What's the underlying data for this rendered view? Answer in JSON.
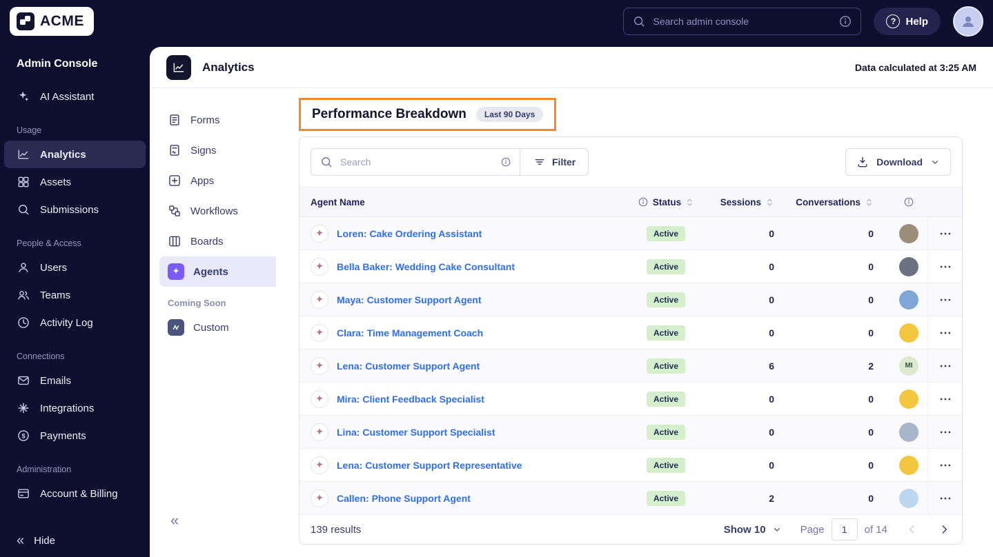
{
  "topbar": {
    "logo_text": "ACME",
    "search_placeholder": "Search admin console",
    "help_label": "Help"
  },
  "sidebar": {
    "title": "Admin Console",
    "ai_assistant_label": "AI Assistant",
    "sections": [
      {
        "label": "Usage",
        "items": [
          {
            "label": "Analytics",
            "active": true
          },
          {
            "label": "Assets"
          },
          {
            "label": "Submissions"
          }
        ]
      },
      {
        "label": "People & Access",
        "items": [
          {
            "label": "Users"
          },
          {
            "label": "Teams"
          },
          {
            "label": "Activity Log"
          }
        ]
      },
      {
        "label": "Connections",
        "items": [
          {
            "label": "Emails"
          },
          {
            "label": "Integrations"
          },
          {
            "label": "Payments"
          }
        ]
      },
      {
        "label": "Administration",
        "items": [
          {
            "label": "Account & Billing"
          }
        ]
      }
    ],
    "hide_label": "Hide"
  },
  "content_header": {
    "title": "Analytics",
    "calculated": "Data calculated at 3:25 AM"
  },
  "subnav": {
    "items": [
      {
        "label": "Forms"
      },
      {
        "label": "Signs"
      },
      {
        "label": "Apps"
      },
      {
        "label": "Workflows"
      },
      {
        "label": "Boards"
      },
      {
        "label": "Agents",
        "active": true
      }
    ],
    "coming_soon_label": "Coming Soon",
    "custom_label": "Custom"
  },
  "panel": {
    "title": "Performance Breakdown",
    "badge": "Last 90 Days",
    "toolbar": {
      "search_placeholder": "Search",
      "filter_label": "Filter",
      "download_label": "Download"
    },
    "table": {
      "headers": {
        "agent": "Agent Name",
        "status": "Status",
        "sessions": "Sessions",
        "conversations": "Conversations"
      },
      "rows": [
        {
          "name": "Loren: Cake Ordering Assistant",
          "status": "Active",
          "sessions": "0",
          "conversations": "0",
          "avatar": {
            "bg": "#9c8c7a",
            "initials": ""
          }
        },
        {
          "name": "Bella Baker: Wedding Cake Consultant",
          "status": "Active",
          "sessions": "0",
          "conversations": "0",
          "avatar": {
            "bg": "#6b7280",
            "initials": ""
          }
        },
        {
          "name": "Maya: Customer Support Agent",
          "status": "Active",
          "sessions": "0",
          "conversations": "0",
          "avatar": {
            "bg": "#7fa6d6",
            "initials": ""
          }
        },
        {
          "name": "Clara: Time Management Coach",
          "status": "Active",
          "sessions": "0",
          "conversations": "0",
          "avatar": {
            "bg": "#f3c63f",
            "initials": ""
          }
        },
        {
          "name": "Lena: Customer Support Agent",
          "status": "Active",
          "sessions": "6",
          "conversations": "2",
          "avatar": {
            "bg": "#dcead0",
            "initials": "MI"
          }
        },
        {
          "name": "Mira: Client Feedback Specialist",
          "status": "Active",
          "sessions": "0",
          "conversations": "0",
          "avatar": {
            "bg": "#f3c63f",
            "initials": ""
          }
        },
        {
          "name": "Lina: Customer Support Specialist",
          "status": "Active",
          "sessions": "0",
          "conversations": "0",
          "avatar": {
            "bg": "#a9b6c9",
            "initials": ""
          }
        },
        {
          "name": "Lena: Customer Support Representative",
          "status": "Active",
          "sessions": "0",
          "conversations": "0",
          "avatar": {
            "bg": "#f3c63f",
            "initials": ""
          }
        },
        {
          "name": "Callen: Phone Support Agent",
          "status": "Active",
          "sessions": "2",
          "conversations": "0",
          "avatar": {
            "bg": "#bcd7ef",
            "initials": ""
          }
        }
      ]
    },
    "footer": {
      "results": "139 results",
      "show_label": "Show 10",
      "page_label": "Page",
      "page_value": "1",
      "of_label": "of 14"
    }
  },
  "colors": {
    "annotation_orange": "#f68a1e",
    "link_blue": "#2f6fed",
    "badge_green_bg": "#d5efcc",
    "agents_purple": "#7a5cf5",
    "sidebar_navy": "#0e0f2e"
  }
}
